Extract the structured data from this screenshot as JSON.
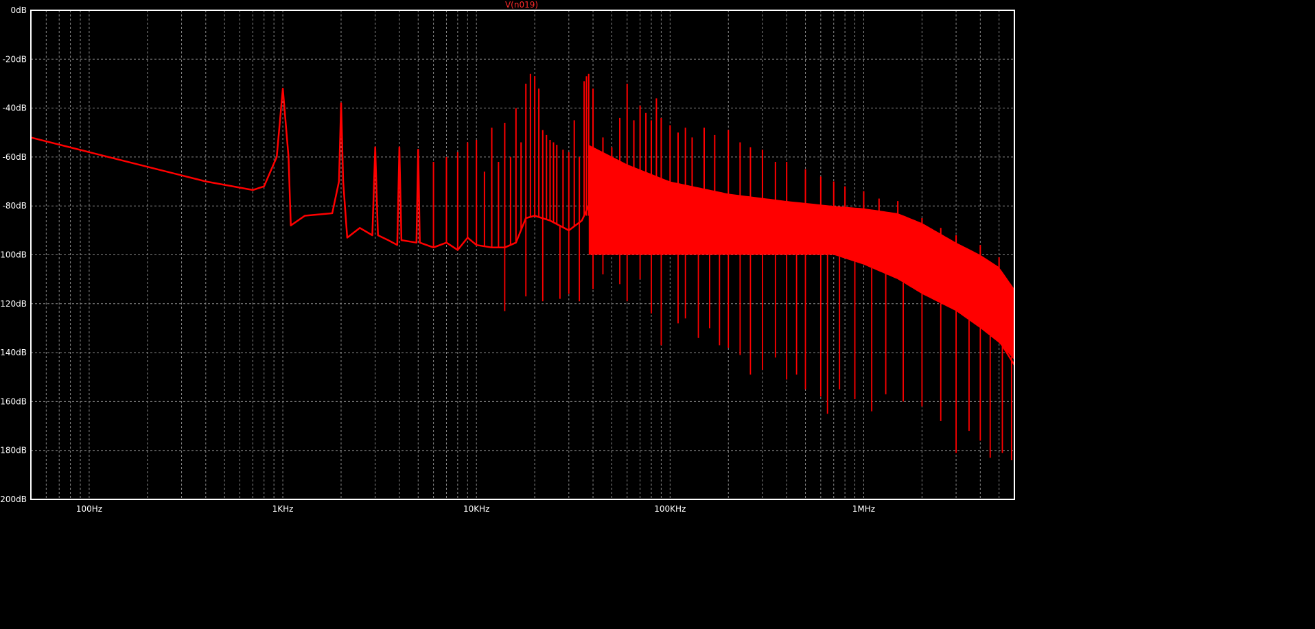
{
  "chart_data": {
    "type": "line",
    "title": "V(n019)",
    "xscale": "log",
    "xlim": [
      50,
      6000000
    ],
    "ylim": [
      -200,
      0
    ],
    "grid": true,
    "x_ticks": [
      {
        "value": 100,
        "label": "100Hz"
      },
      {
        "value": 1000,
        "label": "1KHz"
      },
      {
        "value": 10000,
        "label": "10KHz"
      },
      {
        "value": 100000,
        "label": "100KHz"
      },
      {
        "value": 1000000,
        "label": "1MHz"
      }
    ],
    "y_ticks": [
      {
        "value": 0,
        "label": "0dB"
      },
      {
        "value": -20,
        "label": "-20dB"
      },
      {
        "value": -40,
        "label": "-40dB"
      },
      {
        "value": -60,
        "label": "-60dB"
      },
      {
        "value": -80,
        "label": "-80dB"
      },
      {
        "value": -100,
        "label": "-100dB"
      },
      {
        "value": -120,
        "label": "-120dB"
      },
      {
        "value": -140,
        "label": "-140dB"
      },
      {
        "value": -160,
        "label": "-160dB"
      },
      {
        "value": -180,
        "label": "-180dB"
      },
      {
        "value": -200,
        "label": "-200dB"
      }
    ],
    "series": [
      {
        "name": "V(n019)",
        "color": "#ff0000",
        "points": [
          [
            50,
            -52
          ],
          [
            100,
            -58
          ],
          [
            200,
            -64
          ],
          [
            400,
            -70
          ],
          [
            700,
            -73.5
          ],
          [
            800,
            -72
          ],
          [
            930,
            -60
          ],
          [
            1000,
            -32
          ],
          [
            1070,
            -60
          ],
          [
            1100,
            -88
          ],
          [
            1300,
            -84
          ],
          [
            1800,
            -83
          ],
          [
            1950,
            -70
          ],
          [
            2000,
            -38
          ],
          [
            2050,
            -70
          ],
          [
            2150,
            -93
          ],
          [
            2500,
            -89
          ],
          [
            2900,
            -92
          ],
          [
            3000,
            -56
          ],
          [
            3100,
            -92
          ],
          [
            3500,
            -94
          ],
          [
            3900,
            -96
          ],
          [
            4000,
            -56
          ],
          [
            4100,
            -94
          ],
          [
            4900,
            -95
          ],
          [
            5000,
            -57
          ],
          [
            5100,
            -95
          ],
          [
            6000,
            -97
          ],
          [
            7000,
            -95
          ],
          [
            8000,
            -98
          ],
          [
            9000,
            -93
          ],
          [
            10000,
            -96
          ],
          [
            12000,
            -97
          ],
          [
            14000,
            -97
          ],
          [
            16000,
            -95
          ],
          [
            18000,
            -85
          ],
          [
            20000,
            -84
          ],
          [
            24000,
            -86
          ],
          [
            30000,
            -90
          ],
          [
            35000,
            -86
          ],
          [
            38000,
            -80
          ],
          [
            60000,
            -82
          ],
          [
            100000,
            -85
          ],
          [
            200000,
            -89
          ],
          [
            400000,
            -92
          ],
          [
            700000,
            -96
          ],
          [
            1000000,
            -98
          ],
          [
            1500000,
            -101
          ],
          [
            2000000,
            -105
          ],
          [
            3000000,
            -115
          ],
          [
            4000000,
            -125
          ],
          [
            5000000,
            -135
          ],
          [
            6000000,
            -145
          ]
        ],
        "spikes": [
          [
            6000,
            -62
          ],
          [
            7000,
            -60
          ],
          [
            8000,
            -58
          ],
          [
            9000,
            -54
          ],
          [
            10000,
            -53
          ],
          [
            11000,
            -66
          ],
          [
            12000,
            -48
          ],
          [
            13000,
            -62
          ],
          [
            14000,
            -46
          ],
          [
            15000,
            -60
          ],
          [
            16000,
            -40
          ],
          [
            17000,
            -54
          ],
          [
            18000,
            -30
          ],
          [
            19000,
            -26
          ],
          [
            20000,
            -27
          ],
          [
            21000,
            -32
          ],
          [
            22000,
            -49
          ],
          [
            23000,
            -51
          ],
          [
            24000,
            -53
          ],
          [
            25000,
            -54
          ],
          [
            26000,
            -55
          ],
          [
            28000,
            -57
          ],
          [
            30000,
            -58
          ],
          [
            32000,
            -45
          ],
          [
            34000,
            -60
          ],
          [
            36000,
            -29
          ],
          [
            37000,
            -27
          ],
          [
            38000,
            -26
          ],
          [
            40000,
            -32
          ],
          [
            45000,
            -52
          ],
          [
            50000,
            -56
          ],
          [
            55000,
            -44
          ],
          [
            60000,
            -30
          ],
          [
            65000,
            -45
          ],
          [
            70000,
            -39
          ],
          [
            75000,
            -42
          ],
          [
            80000,
            -45
          ],
          [
            85000,
            -36
          ],
          [
            90000,
            -44
          ],
          [
            100000,
            -47
          ],
          [
            110000,
            -50
          ],
          [
            120000,
            -48
          ],
          [
            130000,
            -52
          ],
          [
            150000,
            -48
          ],
          [
            170000,
            -51
          ],
          [
            200000,
            -49
          ],
          [
            230000,
            -54
          ],
          [
            260000,
            -56
          ],
          [
            300000,
            -57
          ],
          [
            350000,
            -62
          ],
          [
            400000,
            -62
          ],
          [
            500000,
            -65
          ],
          [
            600000,
            -68
          ],
          [
            700000,
            -70
          ],
          [
            800000,
            -72
          ],
          [
            1000000,
            -74
          ],
          [
            1200000,
            -77
          ],
          [
            1500000,
            -78
          ],
          [
            2000000,
            -85
          ],
          [
            2500000,
            -89
          ],
          [
            3000000,
            -92
          ],
          [
            4000000,
            -96
          ],
          [
            5000000,
            -101
          ],
          [
            6000000,
            -108
          ]
        ],
        "envelope_floor": [
          [
            700000,
            -100
          ],
          [
            1000000,
            -104
          ],
          [
            1500000,
            -110
          ],
          [
            2000000,
            -116
          ],
          [
            3000000,
            -123
          ],
          [
            4000000,
            -130
          ],
          [
            5000000,
            -136
          ],
          [
            6000000,
            -143
          ]
        ],
        "envelope_ceiling": [
          [
            38000,
            -55
          ],
          [
            60000,
            -63
          ],
          [
            100000,
            -70
          ],
          [
            200000,
            -75
          ],
          [
            400000,
            -78
          ],
          [
            700000,
            -80
          ],
          [
            1000000,
            -81
          ],
          [
            1500000,
            -83
          ],
          [
            2000000,
            -87
          ],
          [
            3000000,
            -95
          ],
          [
            4000000,
            -100
          ],
          [
            5000000,
            -105
          ],
          [
            6000000,
            -114
          ]
        ],
        "dips": [
          [
            14000,
            -123
          ],
          [
            18000,
            -117
          ],
          [
            22000,
            -119
          ],
          [
            27000,
            -118
          ],
          [
            30000,
            -116
          ],
          [
            34000,
            -119
          ],
          [
            40000,
            -114
          ],
          [
            45000,
            -108
          ],
          [
            55000,
            -112
          ],
          [
            60000,
            -119
          ],
          [
            70000,
            -110
          ],
          [
            80000,
            -124
          ],
          [
            90000,
            -137
          ],
          [
            110000,
            -128
          ],
          [
            120000,
            -126
          ],
          [
            140000,
            -134
          ],
          [
            160000,
            -130
          ],
          [
            180000,
            -137
          ],
          [
            200000,
            -138
          ],
          [
            230000,
            -141
          ],
          [
            260000,
            -149
          ],
          [
            300000,
            -147
          ],
          [
            350000,
            -142
          ],
          [
            400000,
            -151
          ],
          [
            450000,
            -149
          ],
          [
            500000,
            -155
          ],
          [
            600000,
            -158
          ],
          [
            650000,
            -165
          ],
          [
            750000,
            -155
          ],
          [
            900000,
            -159
          ],
          [
            1100000,
            -164
          ],
          [
            1300000,
            -157
          ],
          [
            1600000,
            -160
          ],
          [
            2000000,
            -162
          ],
          [
            2500000,
            -168
          ],
          [
            3000000,
            -181
          ],
          [
            3500000,
            -172
          ],
          [
            4000000,
            -176
          ],
          [
            4500000,
            -183
          ],
          [
            5200000,
            -181
          ],
          [
            5800000,
            -184
          ]
        ]
      }
    ]
  }
}
